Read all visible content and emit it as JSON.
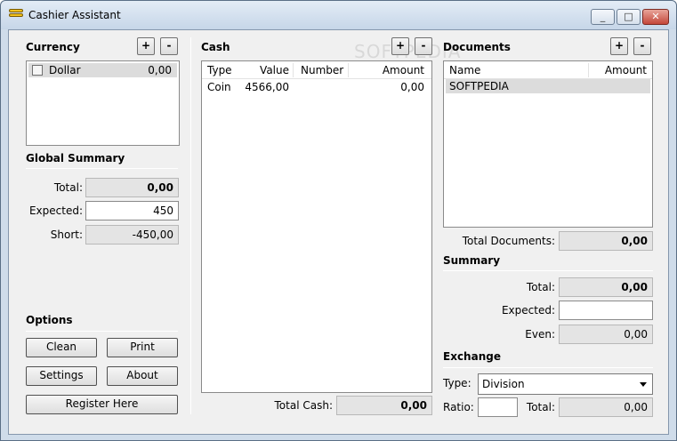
{
  "window": {
    "title": "Cashier Assistant",
    "minimize": "_",
    "maximize": "□",
    "close": "✕"
  },
  "currency": {
    "header": "Currency",
    "add": "+",
    "remove": "-",
    "items": [
      {
        "name": "Dollar",
        "amount": "0,00",
        "checked": false
      }
    ]
  },
  "global_summary": {
    "header": "Global Summary",
    "total_label": "Total:",
    "total_value": "0,00",
    "expected_label": "Expected:",
    "expected_value": "450",
    "short_label": "Short:",
    "short_value": "-450,00"
  },
  "options": {
    "header": "Options",
    "clean": "Clean",
    "print": "Print",
    "settings": "Settings",
    "about": "About",
    "register": "Register Here"
  },
  "cash": {
    "header": "Cash",
    "add": "+",
    "remove": "-",
    "columns": [
      "Type",
      "Value",
      "Number",
      "Amount"
    ],
    "rows": [
      {
        "type": "Coin",
        "value": "4566,00",
        "number": "",
        "amount": "0,00"
      }
    ],
    "total_label": "Total Cash:",
    "total_value": "0,00"
  },
  "documents": {
    "header": "Documents",
    "add": "+",
    "remove": "-",
    "columns": [
      "Name",
      "Amount"
    ],
    "rows": [
      {
        "name": "SOFTPEDIA",
        "amount": ""
      }
    ],
    "total_label": "Total Documents:",
    "total_value": "0,00"
  },
  "summary": {
    "header": "Summary",
    "total_label": "Total:",
    "total_value": "0,00",
    "expected_label": "Expected:",
    "expected_value": "",
    "even_label": "Even:",
    "even_value": "0,00"
  },
  "exchange": {
    "header": "Exchange",
    "type_label": "Type:",
    "type_value": "Division",
    "ratio_label": "Ratio:",
    "ratio_value": "",
    "total_label": "Total:",
    "total_value": "0,00"
  },
  "watermark": "SOFTPEDIA"
}
